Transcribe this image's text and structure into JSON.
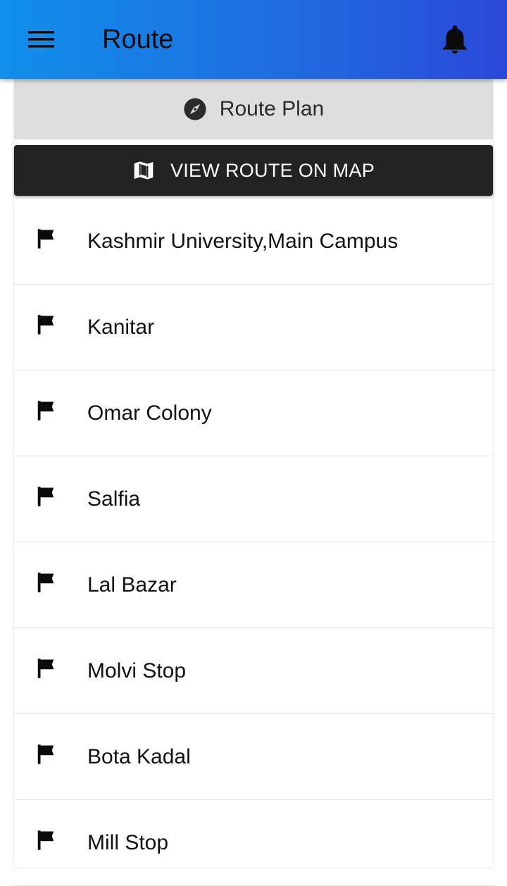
{
  "appbar": {
    "title": "Route",
    "menu_icon": "menu-icon",
    "notification_icon": "bell-icon",
    "gradient": [
      "#0f8fea",
      "#2a48d8"
    ]
  },
  "route_card": {
    "header_icon": "compass-icon",
    "header_label": "Route Plan",
    "map_button": {
      "icon": "map-icon",
      "label": "VIEW ROUTE ON MAP",
      "color": "#222222"
    },
    "stop_icon": "flag-icon",
    "stops": [
      "Kashmir University,Main Campus",
      "Kanitar",
      "Omar Colony",
      "Salfia",
      "Lal Bazar",
      "Molvi Stop",
      "Bota Kadal",
      "Mill Stop"
    ]
  }
}
